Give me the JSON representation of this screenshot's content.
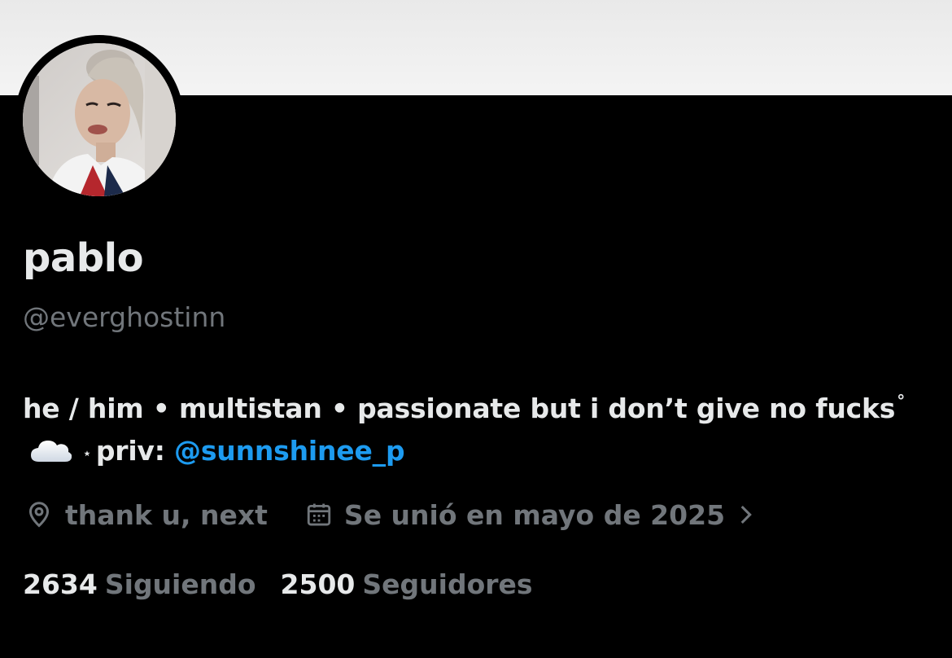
{
  "profile": {
    "display_name": "pablo",
    "handle": "@everghostinn"
  },
  "bio": {
    "part1": "he / him • multistan • passionate but i don’t give no fucks",
    "degree": "°",
    "cloud_icon": "cloud-emoji",
    "star": "⋆",
    "priv_label": "priv:",
    "mention": "@sunnshinee_p"
  },
  "meta": {
    "location": "thank u, next",
    "location_icon": "location-pin-icon",
    "joined": "Se unió en mayo de 2025",
    "joined_icon": "calendar-icon"
  },
  "stats": {
    "following_count": "2634",
    "following_label": "Siguiendo",
    "followers_count": "2500",
    "followers_label": "Seguidores"
  },
  "colors": {
    "background": "#000000",
    "primary_text": "#e7e9ea",
    "secondary_text": "#71767b",
    "link": "#1d9bf0",
    "banner": "#f0f0f0"
  }
}
